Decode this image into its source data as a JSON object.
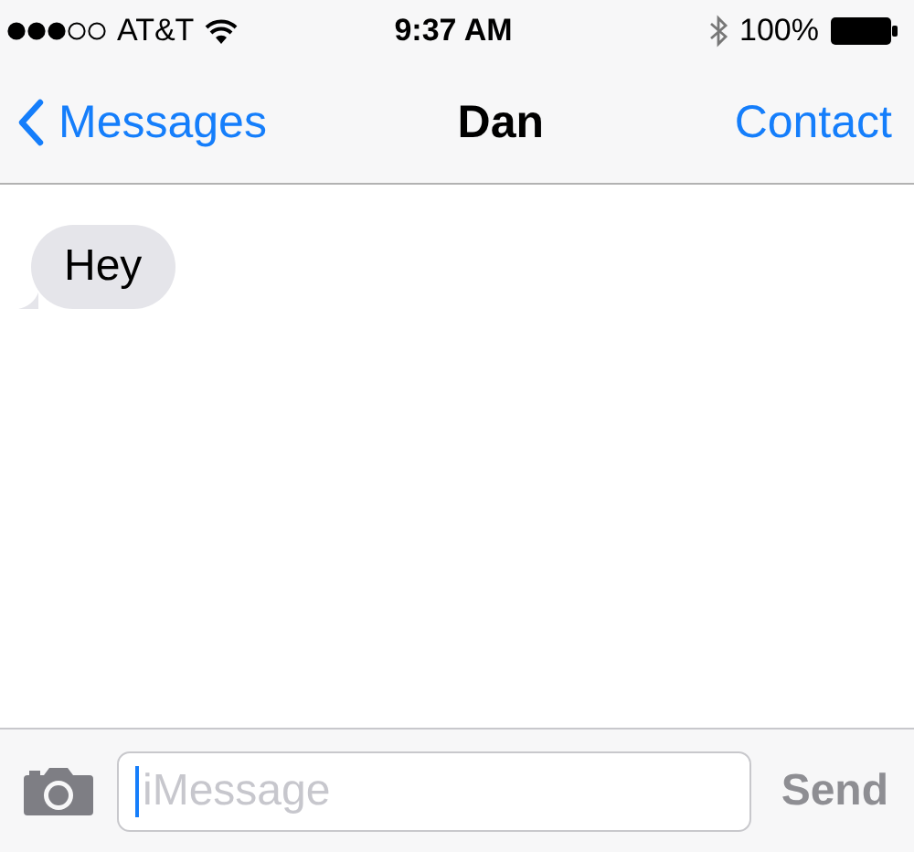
{
  "status_bar": {
    "carrier": "AT&T",
    "time": "9:37 AM",
    "battery": "100%"
  },
  "nav": {
    "back": "Messages",
    "title": "Dan",
    "action": "Contact"
  },
  "messages": [
    {
      "text": "Hey",
      "incoming": true
    }
  ],
  "composer": {
    "placeholder": "iMessage",
    "focused": true,
    "send": {
      "label": "Send",
      "disabled": true
    }
  }
}
